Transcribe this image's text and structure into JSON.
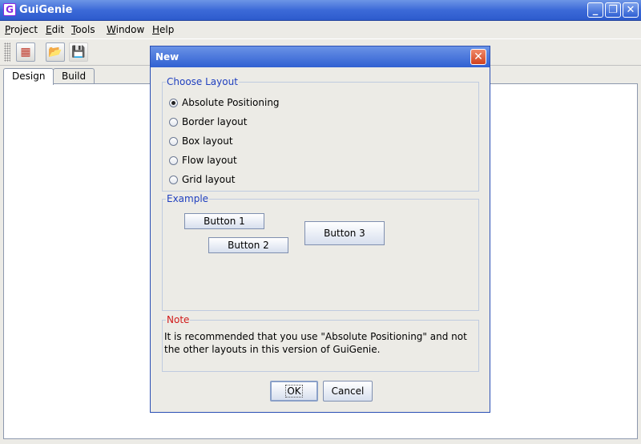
{
  "window": {
    "title": "GuiGenie",
    "minimize_glyph": "_",
    "maximize_glyph": "❐",
    "close_glyph": "✕"
  },
  "menubar": {
    "items": [
      {
        "label": "Project",
        "mnemonic": "P",
        "rest": "roject"
      },
      {
        "label": "Edit",
        "mnemonic": "E",
        "rest": "dit"
      },
      {
        "label": "Tools",
        "mnemonic": "T",
        "rest": "ools"
      },
      {
        "label": "Window",
        "mnemonic": "W",
        "rest": "indow"
      },
      {
        "label": "Help",
        "mnemonic": "H",
        "rest": "elp"
      }
    ]
  },
  "toolbar": {
    "buttons": [
      {
        "icon": "new-project-icon",
        "glyph": "▦"
      },
      {
        "icon": "open-folder-icon",
        "glyph": "📂"
      },
      {
        "icon": "save-icon",
        "glyph": "💾"
      }
    ]
  },
  "tabs": [
    {
      "label": "Design",
      "active": true
    },
    {
      "label": "Build",
      "active": false
    }
  ],
  "dialog": {
    "title": "New",
    "close_glyph": "✕",
    "choose_layout": {
      "legend": "Choose Layout",
      "options": [
        {
          "label": "Absolute Positioning",
          "checked": true
        },
        {
          "label": "Border layout",
          "checked": false
        },
        {
          "label": "Box layout",
          "checked": false
        },
        {
          "label": "Flow layout",
          "checked": false
        },
        {
          "label": "Grid layout",
          "checked": false
        }
      ]
    },
    "example": {
      "legend": "Example",
      "buttons": [
        "Button 1",
        "Button 2",
        "Button 3"
      ]
    },
    "note": {
      "legend": "Note",
      "text": "It is recommended that you use \"Absolute Positioning\" and not the other layouts in this version of GuiGenie."
    },
    "ok_label": "OK",
    "cancel_label": "Cancel"
  },
  "colors": {
    "title_bar": "#3c6ad8",
    "legend_blue": "#1f3fbf",
    "legend_red": "#d11a1a",
    "dialog_close": "#d0421f"
  }
}
